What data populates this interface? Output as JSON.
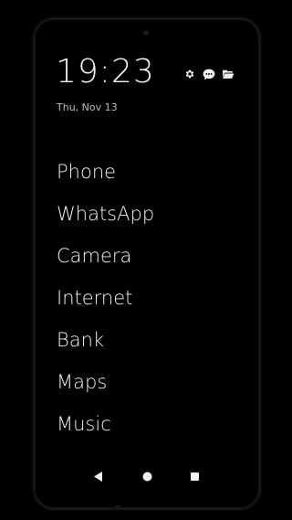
{
  "status": {
    "time": "19:23",
    "date": "Thu, Nov 13"
  },
  "header_icons": [
    {
      "icon": "gear-icon"
    },
    {
      "icon": "chat-bubble-icon"
    },
    {
      "icon": "folder-open-icon"
    }
  ],
  "apps": [
    {
      "label": "Phone"
    },
    {
      "label": "WhatsApp"
    },
    {
      "label": "Camera"
    },
    {
      "label": "Internet"
    },
    {
      "label": "Bank"
    },
    {
      "label": "Maps"
    },
    {
      "label": "Music"
    }
  ],
  "navigation": {
    "buttons": [
      "back-icon",
      "home-icon",
      "recents-icon"
    ]
  },
  "colors": {
    "background": "#000000",
    "text": "#f0f0f0",
    "secondary_text": "#bdbdbd",
    "frame": "#1c1f22"
  }
}
